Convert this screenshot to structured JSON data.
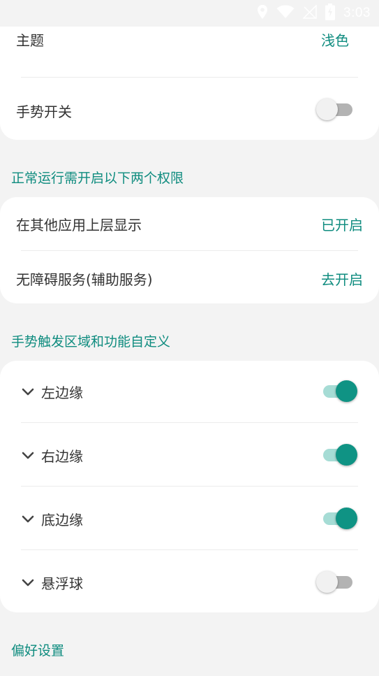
{
  "status_bar": {
    "time": "3:03",
    "icons": [
      "location-icon",
      "wifi-icon",
      "signal-off-icon",
      "battery-charging-icon"
    ]
  },
  "top_card": {
    "theme_label": "主题",
    "theme_value": "浅色",
    "gesture_switch_label": "手势开关",
    "gesture_switch_on": false
  },
  "permissions": {
    "section_title": "正常运行需开启以下两个权限",
    "overlay_label": "在其他应用上层显示",
    "overlay_value": "已开启",
    "accessibility_label": "无障碍服务(辅助服务)",
    "accessibility_value": "去开启"
  },
  "gesture_areas": {
    "section_title": "手势触发区域和功能自定义",
    "items": [
      {
        "label": "左边缘",
        "enabled": true
      },
      {
        "label": "右边缘",
        "enabled": true
      },
      {
        "label": "底边缘",
        "enabled": true
      },
      {
        "label": "悬浮球",
        "enabled": false
      }
    ]
  },
  "preferences": {
    "section_title": "偏好设置"
  },
  "colors": {
    "accent": "#0f8c7f",
    "switch_on_thumb": "#0f9384",
    "switch_on_track": "#a6dcd5",
    "switch_off_track": "#b3b3b3",
    "background": "#f3f3f3",
    "card": "#ffffff"
  }
}
